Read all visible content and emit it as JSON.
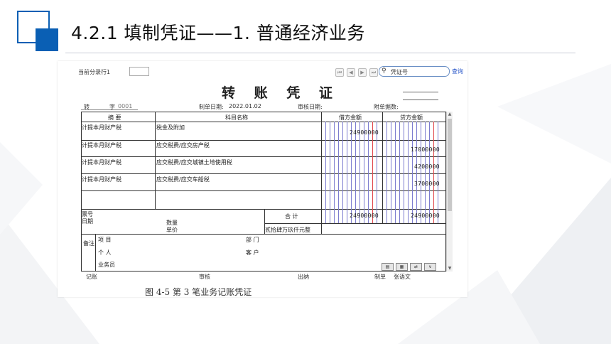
{
  "slide": {
    "title": "4.2.1  填制凭证——1. 普通经济业务"
  },
  "voucher": {
    "current_row_label": "当前分录行1",
    "search_placeholder": "凭证号",
    "query_label": "查询",
    "title": "转 账 凭 证",
    "type_label": "转",
    "number_label": "字",
    "number_value": "0001",
    "make_date_label": "制单日期:",
    "make_date_value": "2022.01.02",
    "audit_date_label": "审核日期:",
    "attach_label": "附单据数:",
    "columns": {
      "summary": "摘 要",
      "account": "科目名称",
      "debit": "借方金额",
      "credit": "贷方金额"
    },
    "entries": [
      {
        "summary": "计提本月财产税",
        "account": "税金及附加",
        "debit": "24900000",
        "credit": ""
      },
      {
        "summary": "计提本月财产税",
        "account": "应交税费/应交房产税",
        "debit": "",
        "credit": "17000000"
      },
      {
        "summary": "计提本月财产税",
        "account": "应交税费/应交城镇土地使用税",
        "debit": "",
        "credit": "4200000"
      },
      {
        "summary": "计提本月财产税",
        "account": "应交税费/应交车船税",
        "debit": "",
        "credit": "3700000"
      }
    ],
    "ticket_no_label": "票号",
    "date_label": "日期",
    "quantity_label": "数量",
    "unit_price_label": "单价",
    "total_label": "合 计",
    "total_debit": "24900000",
    "total_credit": "24900000",
    "amount_words": "贰拾肆万玖仟元整",
    "remark_label": "备注",
    "project_label": "项  目",
    "department_label": "部  门",
    "personal_label": "个  人",
    "customer_label": "客  户",
    "salesman_label": "业务员",
    "bookkeeper_label": "记账",
    "auditor_label": "审核",
    "cashier_label": "出纳",
    "maker_label": "制单",
    "maker_name": "张语文"
  },
  "caption": "图 4-5  第 3 笔业务记账凭证"
}
